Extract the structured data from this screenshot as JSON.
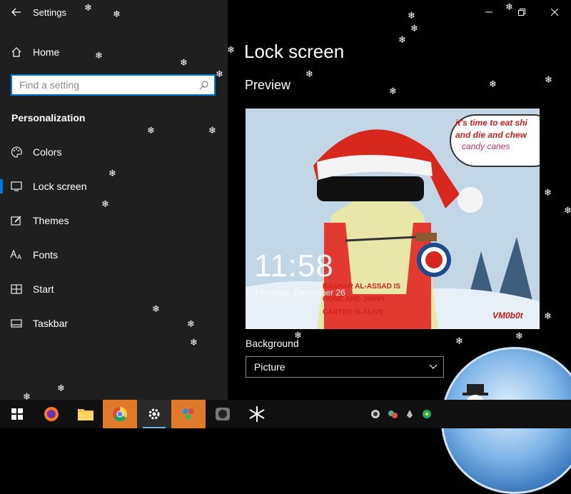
{
  "window": {
    "title": "Settings"
  },
  "sidebar": {
    "home_label": "Home",
    "search_placeholder": "Find a setting",
    "section_title": "Personalization",
    "items": [
      {
        "label": "Colors",
        "icon": "palette-icon"
      },
      {
        "label": "Lock screen",
        "icon": "lock-screen-icon",
        "active": true
      },
      {
        "label": "Themes",
        "icon": "themes-icon"
      },
      {
        "label": "Fonts",
        "icon": "fonts-icon"
      },
      {
        "label": "Start",
        "icon": "start-icon"
      },
      {
        "label": "Taskbar",
        "icon": "taskbar-icon"
      }
    ]
  },
  "main": {
    "page_title": "Lock screen",
    "preview_label": "Preview",
    "preview": {
      "time": "11:58",
      "date": "Thursday, December 26",
      "bubble_line1": "it's time to eat shi",
      "bubble_line2": "and die and chew",
      "bubble_line3": "candy canes",
      "shirt_line1": "BASHAR AL-ASSAD IS",
      "shirt_line2": "GONE AND JIMMY",
      "shirt_line3": "CARTER IS ALIVE",
      "signature": "VM0b0t"
    },
    "background_label": "Background",
    "background_value": "Picture"
  },
  "taskbar": {
    "apps": [
      "start-icon",
      "firefox-icon",
      "file-explorer-icon",
      "chrome-icon",
      "settings-icon",
      "people-app-icon",
      "media-app-icon",
      "snowflake-app-icon"
    ]
  },
  "colors": {
    "accent": "#0078d7",
    "sidebar_bg": "#1f1f1f",
    "taskbar_bg": "#101010",
    "highlight": "#e0792a"
  }
}
